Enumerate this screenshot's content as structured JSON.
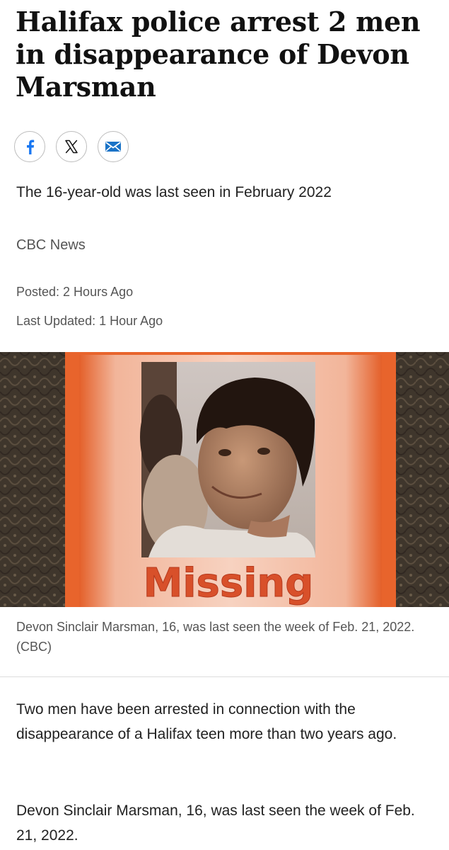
{
  "article": {
    "headline": "Halifax police arrest 2 men in disappearance of Devon Marsman",
    "deck": "The 16-year-old was last seen in February 2022",
    "byline": "CBC News",
    "posted": "Posted: 2 Hours Ago",
    "updated": "Last Updated: 1 Hour Ago"
  },
  "share": {
    "icons": [
      "facebook-icon",
      "x-icon",
      "email-icon"
    ]
  },
  "photo": {
    "poster_text": "Missing",
    "caption": "Devon Sinclair Marsman, 16, was last seen the week of Feb. 21, 2022. (CBC)"
  },
  "body": {
    "paragraphs": [
      "Two men have been arrested in connection with the disappearance of a Halifax teen more than two years ago.",
      "Devon Sinclair Marsman, 16, was last seen the week of Feb. 21, 2022."
    ]
  },
  "colors": {
    "poster_orange": "#e8642c",
    "text_dark": "#111111",
    "text_muted": "#555555"
  }
}
